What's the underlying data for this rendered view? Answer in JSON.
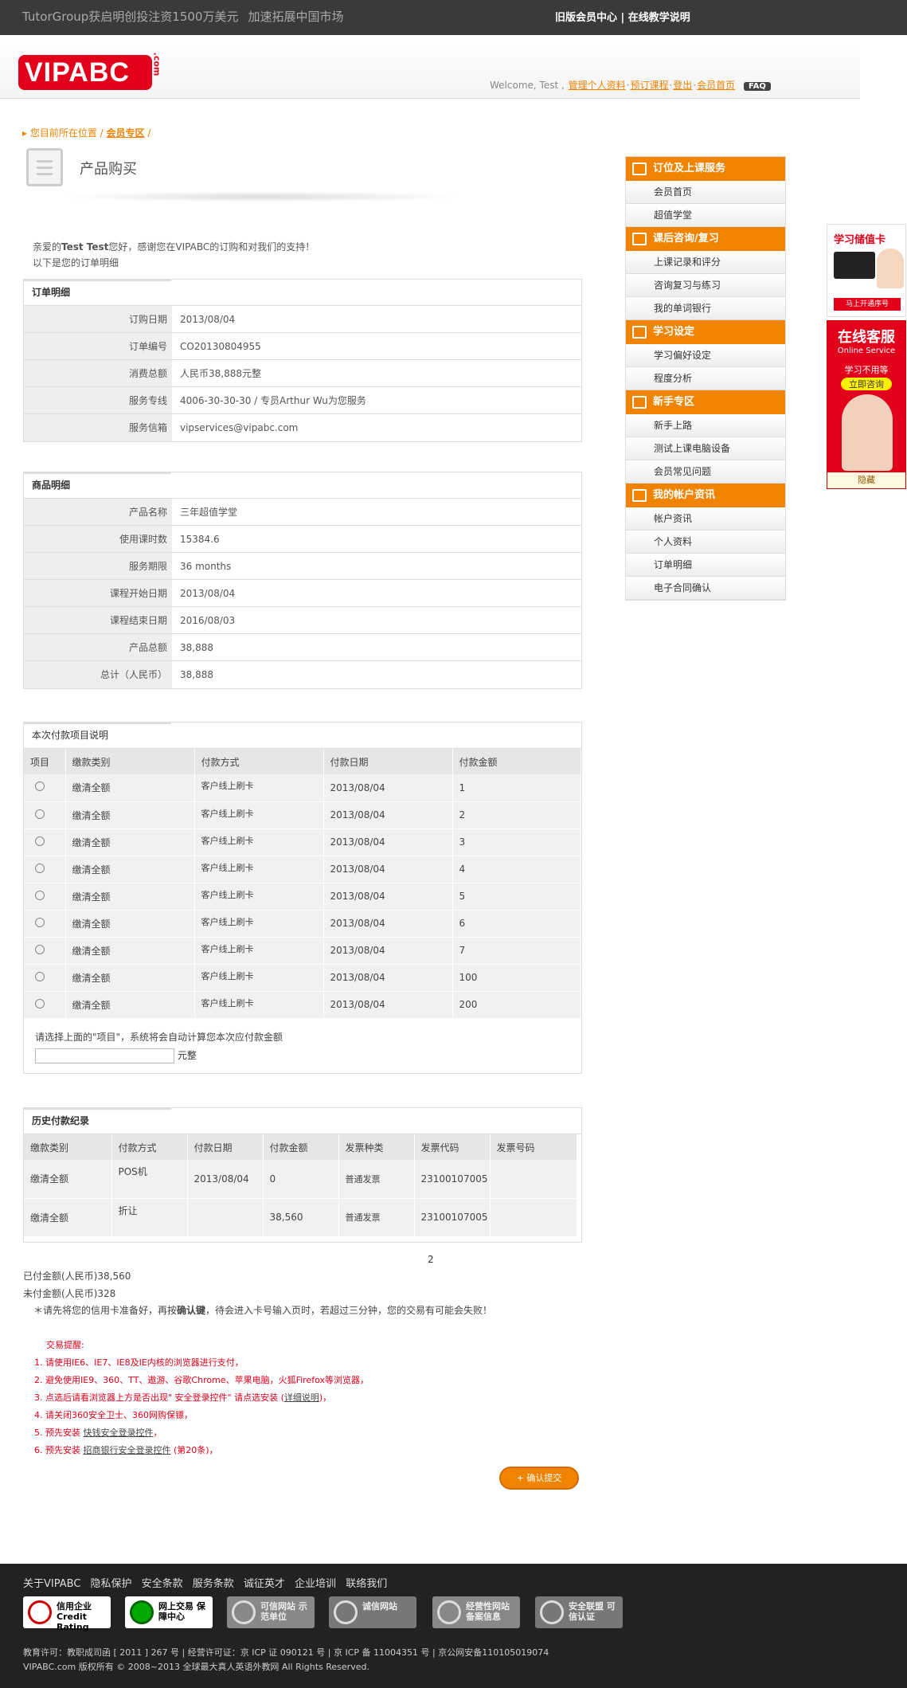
{
  "topbar": {
    "news": "TutorGroup获启明创投注资1500万美元",
    "news2": "加速拓展中国市场",
    "links": "旧版会员中心 | 在线教学说明"
  },
  "header": {
    "logo": "VIPABC",
    "logo_com": ".com",
    "welcome": "Welcome, Test ,",
    "links": [
      "管理个人资料",
      "预订课程",
      "登出",
      "会员首页"
    ],
    "faq": "FAQ"
  },
  "breadcrumb": {
    "prefix": "您目前所在位置 / ",
    "link": "会员专区",
    "suffix": " /"
  },
  "page_title": "产品购买",
  "intro": {
    "line1_pre": "亲爱的",
    "name": "Test Test",
    "line1_post": "您好，感谢您在VIPABC的订购和对我们的支持！",
    "line2": "以下是您的订单明细"
  },
  "order": {
    "title": "订单明细",
    "rows": [
      {
        "k": "订购日期",
        "v": "2013/08/04"
      },
      {
        "k": "订单编号",
        "v": "CO20130804955"
      },
      {
        "k": "消费总额",
        "v": "人民币38,888元整"
      },
      {
        "k": "服务专线",
        "v": "4006-30-30-30 / 专员Arthur Wu为您服务"
      },
      {
        "k": "服务信箱",
        "v": "vipservices@vipabc.com"
      }
    ]
  },
  "product": {
    "title": "商品明细",
    "rows": [
      {
        "k": "产品名称",
        "v": "三年超值学堂"
      },
      {
        "k": "使用课时数",
        "v": "15384.6"
      },
      {
        "k": "服务期限",
        "v": "36 months"
      },
      {
        "k": "课程开始日期",
        "v": "2013/08/04"
      },
      {
        "k": "课程结束日期",
        "v": "2016/08/03"
      },
      {
        "k": "产品总额",
        "v": "38,888"
      },
      {
        "k": "总计（人民币）",
        "v": "38,888"
      }
    ]
  },
  "payment": {
    "title": "本次付款项目说明",
    "headers": [
      "项目",
      "缴款类别",
      "付款方式",
      "付款日期",
      "付款金额"
    ],
    "rows": [
      {
        "type": "缴清全额",
        "method": "客户线上刷卡",
        "date": "2013/08/04",
        "amount": "1"
      },
      {
        "type": "缴清全额",
        "method": "客户线上刷卡",
        "date": "2013/08/04",
        "amount": "2"
      },
      {
        "type": "缴清全额",
        "method": "客户线上刷卡",
        "date": "2013/08/04",
        "amount": "3"
      },
      {
        "type": "缴清全额",
        "method": "客户线上刷卡",
        "date": "2013/08/04",
        "amount": "4"
      },
      {
        "type": "缴清全额",
        "method": "客户线上刷卡",
        "date": "2013/08/04",
        "amount": "5"
      },
      {
        "type": "缴清全额",
        "method": "客户线上刷卡",
        "date": "2013/08/04",
        "amount": "6"
      },
      {
        "type": "缴清全额",
        "method": "客户线上刷卡",
        "date": "2013/08/04",
        "amount": "7"
      },
      {
        "type": "缴清全额",
        "method": "客户线上刷卡",
        "date": "2013/08/04",
        "amount": "100"
      },
      {
        "type": "缴清全额",
        "method": "客户线上刷卡",
        "date": "2013/08/04",
        "amount": "200"
      }
    ],
    "hint": "请选择上面的\"项目\"，系统将会自动计算您本次应付款金额",
    "unit": "元整",
    "amount_value": ""
  },
  "history": {
    "title": "历史付款纪录",
    "headers": [
      "缴款类别",
      "付款方式",
      "付款日期",
      "付款金额",
      "发票种类",
      "发票代码",
      "发票号码"
    ],
    "rows": [
      [
        "缴清全额",
        "POS机",
        "2013/08/04",
        "0",
        "普通发票",
        "23100107005",
        ""
      ],
      [
        "缴清全额",
        "折让",
        "",
        "38,560",
        "普通发票",
        "23100107005",
        ""
      ]
    ]
  },
  "page_num": "2",
  "paid": {
    "paid": "已付金额(人民币)38,560",
    "unpaid": "未付金额(人民币)328"
  },
  "notice": {
    "pre": "＊请先将您的信用卡准备好，再按",
    "bold": "确认键",
    "post": "，待会进入卡号输入页时，若超过三分钟，您的交易有可能会失败！"
  },
  "tips": {
    "title": "交易提醒:",
    "items": [
      {
        "text": "1. 请使用IE6、IE7、IE8及IE内核的浏览器进行支付，",
        "link": "",
        "post": ""
      },
      {
        "text": "2. 避免使用IE9、360、TT、遨游、谷歌Chrome、苹果电脑，火狐Firefox等浏览器，",
        "link": "",
        "post": ""
      },
      {
        "text": "3. 点选后请看浏览器上方是否出现\" 安全登录控件\" 请点选安装 (",
        "link": "详细说明",
        "post": ")，"
      },
      {
        "text": "4. 请关闭360安全卫士、360网购保镖，",
        "link": "",
        "post": ""
      },
      {
        "text": "5. 预先安装 ",
        "link": "快钱安全登录控件",
        "post": "，"
      },
      {
        "text": "6. 预先安装 ",
        "link": "招商银行安全登录控件",
        "post": " (第20条)，"
      }
    ]
  },
  "submit": "+ 确认提交",
  "sidebar": [
    {
      "title": "订位及上课服务",
      "items": [
        "会员首页",
        "超值学堂"
      ]
    },
    {
      "title": "课后咨询/复习",
      "items": [
        "上课记录和评分",
        "咨询复习与练习",
        "我的单词银行"
      ]
    },
    {
      "title": "学习设定",
      "items": [
        "学习偏好设定",
        "程度分析"
      ]
    },
    {
      "title": "新手专区",
      "items": [
        "新手上路",
        "测试上课电脑设备",
        "会员常见问题"
      ]
    },
    {
      "title": "我的帐户资讯",
      "items": [
        "帐户资讯",
        "个人资料",
        "订单明细",
        "电子合同确认"
      ]
    }
  ],
  "card": {
    "title": "学习储值卡",
    "btn": "马上开通序号"
  },
  "service": {
    "title": "在线客服",
    "sub": "Online Service",
    "line": "学习不用等",
    "btn": "立即咨询",
    "hide": "隐藏"
  },
  "footer": {
    "links": "关于VIPABC 隐私保护 安全条款 服务条款 诚征英才 企业培训 联络我们",
    "badges": [
      "信用企业 Credit Rating",
      "网上交易 保障中心",
      "",
      "可信网站 示范单位",
      "诚信网站",
      "经营性网站 备案信息",
      "安全联盟 可信认证"
    ],
    "copy1": "教育许可：教职成司函 [ 2011 ] 267 号 | 经营许可证：京 ICP 证 090121 号 | 京 ICP 备 11004351 号 | 京公网安备110105019074",
    "copy2": "VIPABC.com 版权所有 © 2008~2013 全球最大真人英语外教网 All Rights Reserved."
  }
}
